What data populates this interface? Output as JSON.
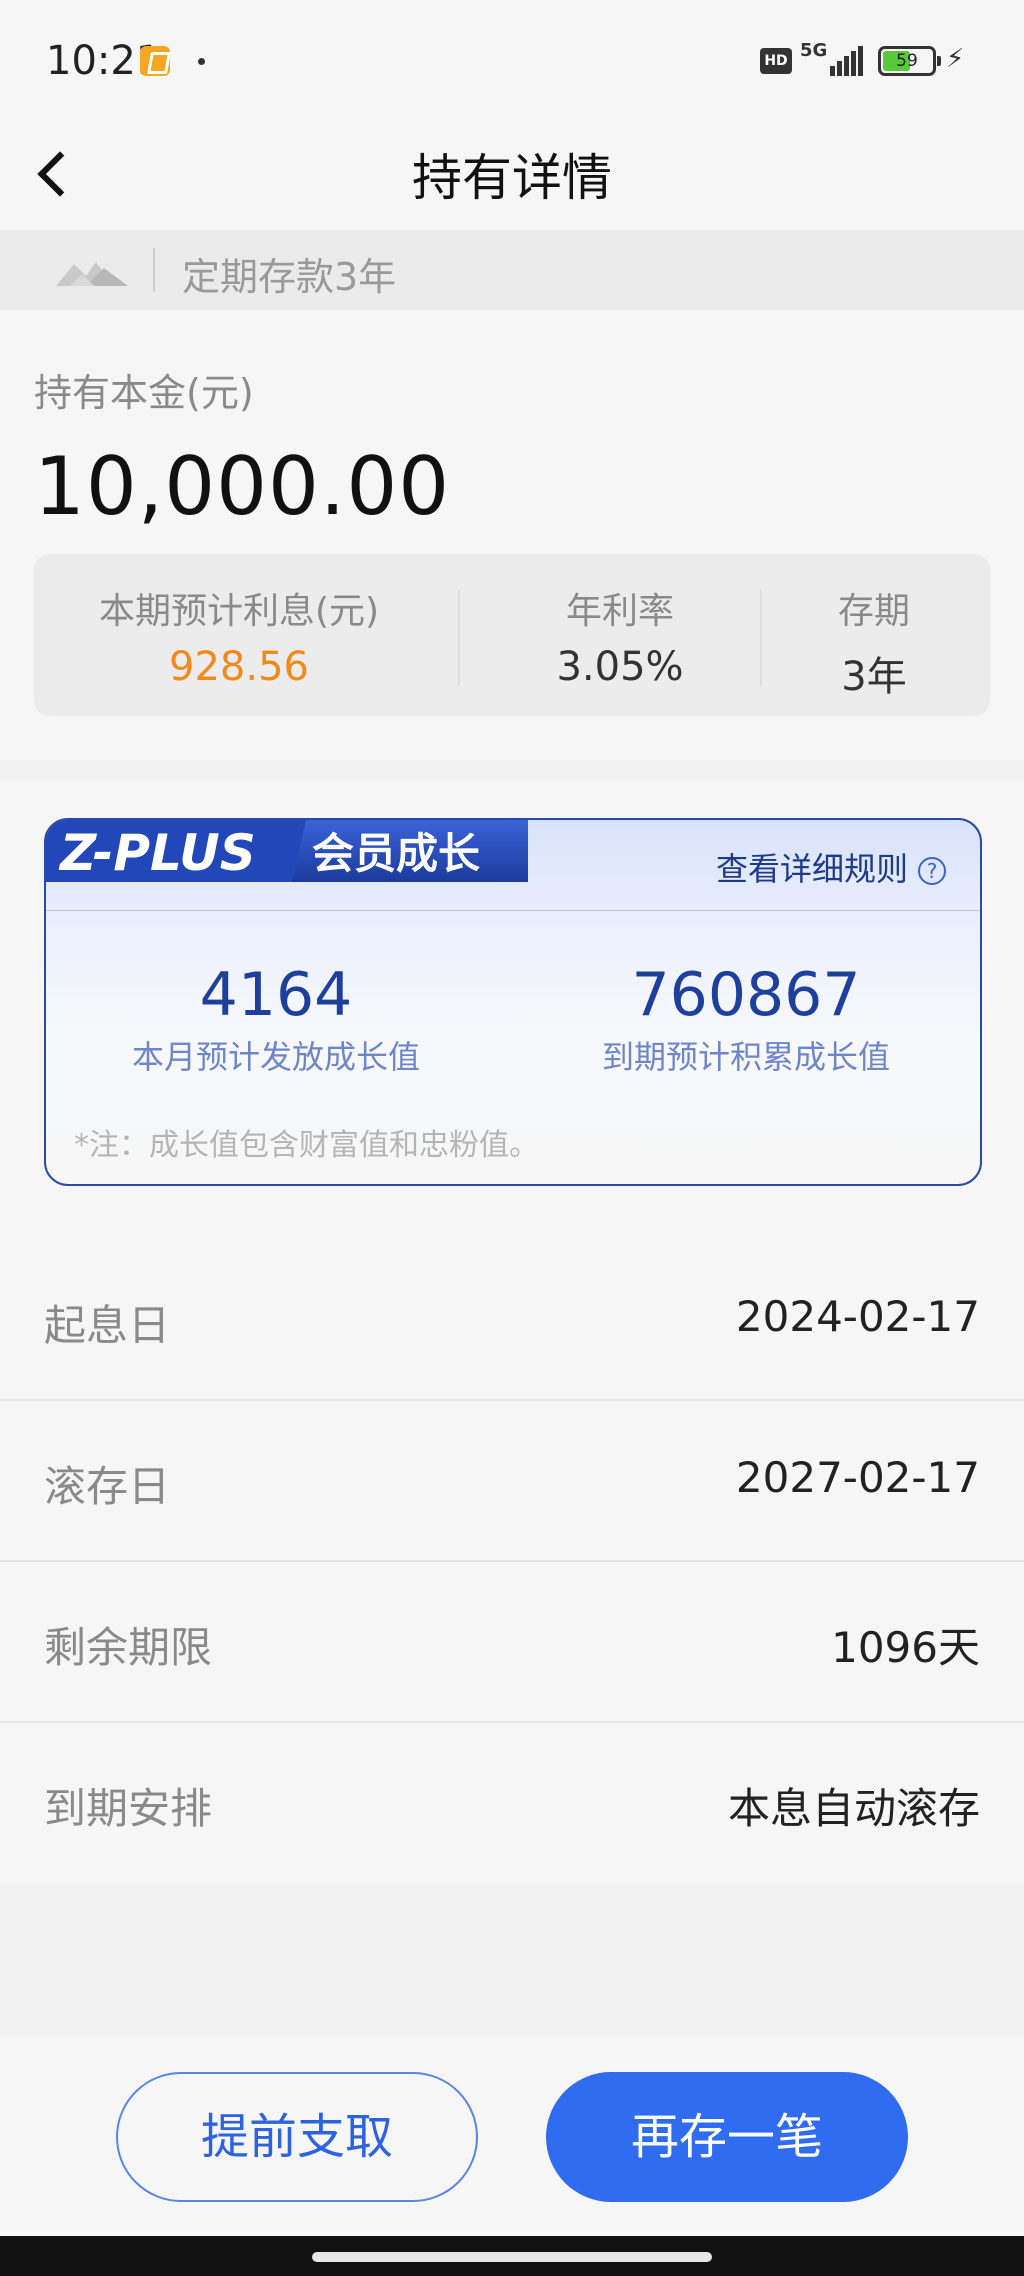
{
  "status_bar": {
    "time": "10:21",
    "hd": "HD",
    "network": "5G",
    "battery": "59",
    "battery_level": 0.59
  },
  "nav": {
    "title": "持有详情"
  },
  "product": {
    "name": "定期存款3年",
    "logo_icon": "mountain-logo-icon"
  },
  "principal": {
    "label": "持有本金(元)",
    "value": "10,000.00"
  },
  "stats": {
    "interest_label": "本期预计利息(元)",
    "interest_value": "928.56",
    "rate_label": "年利率",
    "rate_value": "3.05%",
    "term_label": "存期",
    "term_value": "3年"
  },
  "zplus": {
    "badge_text": "Z-PLUS",
    "badge_subtitle": "会员成长",
    "rules_link": "查看详细规则",
    "help_icon": "?",
    "monthly_value": "4164",
    "monthly_label": "本月预计发放成长值",
    "accum_value": "760867",
    "accum_label": "到期预计积累成长值",
    "note": "*注：成长值包含财富值和忠粉值。"
  },
  "details": [
    {
      "key": "起息日",
      "value": "2024-02-17"
    },
    {
      "key": "滚存日",
      "value": "2027-02-17"
    },
    {
      "key": "剩余期限",
      "value": "1096天"
    },
    {
      "key": "到期安排",
      "value": "本息自动滚存"
    }
  ],
  "actions": {
    "withdraw_label": "提前支取",
    "deposit_label": "再存一笔"
  },
  "colors": {
    "accent_blue": "#2f6cf0",
    "interest_orange": "#f08a1c",
    "zplus_navy": "#1f3f9d"
  }
}
